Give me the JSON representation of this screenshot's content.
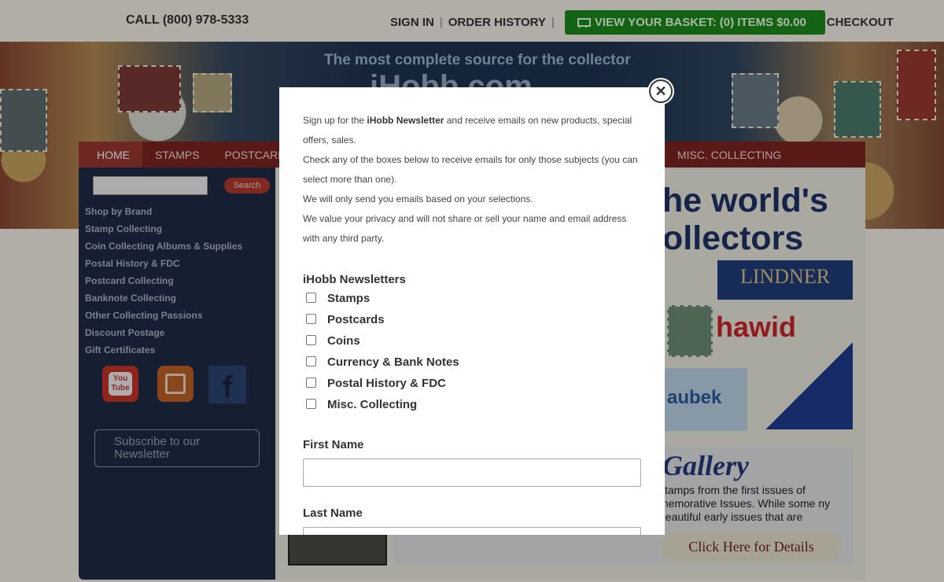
{
  "header": {
    "phone": "CALL (800) 978-5333",
    "sign_in": "SIGN IN",
    "order_history": "ORDER HISTORY",
    "basket": "VIEW YOUR BASKET: (0) ITEMS $0.00",
    "checkout": "CHECKOUT",
    "separator": "|"
  },
  "banner": {
    "tagline": "The most complete source for the collector",
    "site_name": "iHobb.com"
  },
  "nav": {
    "items": [
      "HOME",
      "STAMPS",
      "POSTCARDS"
    ],
    "misc": "MISC. COLLECTING"
  },
  "sidebar": {
    "search_button": "Search",
    "menu": [
      "Shop by Brand",
      "Stamp Collecting",
      "Coin Collecting Albums & Supplies",
      "Postal History & FDC",
      "Postcard Collecting",
      "Banknote Collecting",
      "Other Collecting Passions",
      "Discount Postage",
      "Gift Certificates"
    ],
    "subscribe": "Subscribe to our Newsletter"
  },
  "content": {
    "headline_line1": "he world's",
    "headline_line2": "ollectors",
    "brands": {
      "lindner": "LINDNER",
      "hawid": "hawid",
      "kaubek": "aubek"
    },
    "gallery_title": "Gallery",
    "gallery_text": "stamps from the first issues of memorative Issues. While some ny beautiful early issues that are",
    "gallery_button": "Click Here for Details"
  },
  "modal": {
    "intro_pre": "Sign up for the ",
    "intro_bold": "iHobb Newsletter",
    "intro_post": " and receive emails on new products, special offers, sales.",
    "line2": "Check any of the boxes below to receive emails for only those subjects (you can select more than one).",
    "line3": "We will only send you emails based on your selections.",
    "line4": "We value your privacy and will not share or sell your name and email address with any third party.",
    "newsletters_heading": "iHobb Newsletters",
    "options": [
      {
        "label": "Stamps",
        "checked": false
      },
      {
        "label": "Postcards",
        "checked": false
      },
      {
        "label": "Coins",
        "checked": false
      },
      {
        "label": "Currency & Bank Notes",
        "checked": false
      },
      {
        "label": "Postal History & FDC",
        "checked": false
      },
      {
        "label": "Misc. Collecting",
        "checked": false
      }
    ],
    "first_name_label": "First Name",
    "first_name_value": "",
    "last_name_label": "Last Name",
    "last_name_value": "",
    "close_glyph": "✕"
  },
  "colors": {
    "basket_green": "#1c8a1c",
    "nav_red": "#7b2321",
    "sidebar_navy": "#1f2c46",
    "overlay": "rgba(0,0,0,0.28)"
  },
  "icons": [
    "cart-icon",
    "youtube-icon",
    "blog-icon",
    "facebook-icon",
    "close-icon"
  ]
}
